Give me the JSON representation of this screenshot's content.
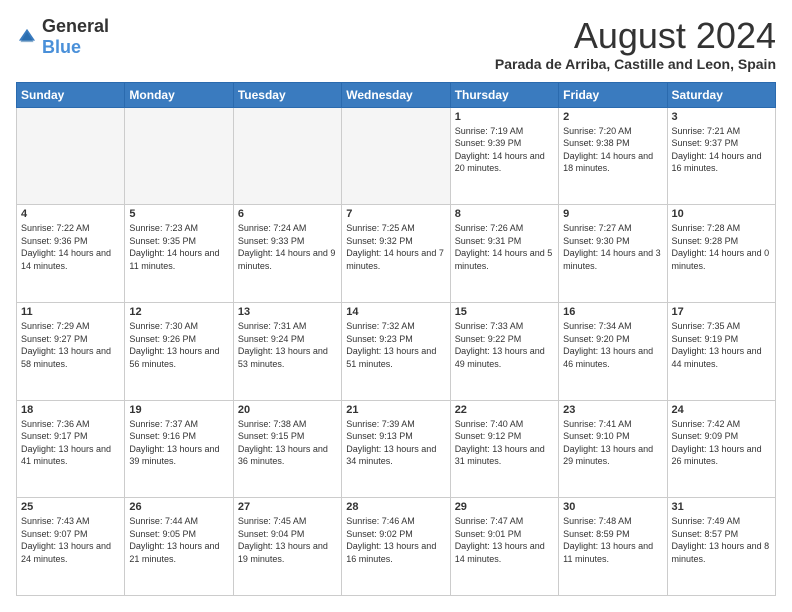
{
  "header": {
    "logo": {
      "general": "General",
      "blue": "Blue"
    },
    "title": "August 2024",
    "location": "Parada de Arriba, Castille and Leon, Spain"
  },
  "days_of_week": [
    "Sunday",
    "Monday",
    "Tuesday",
    "Wednesday",
    "Thursday",
    "Friday",
    "Saturday"
  ],
  "weeks": [
    [
      {
        "day": "",
        "info": ""
      },
      {
        "day": "",
        "info": ""
      },
      {
        "day": "",
        "info": ""
      },
      {
        "day": "",
        "info": ""
      },
      {
        "day": "1",
        "info": "Sunrise: 7:19 AM\nSunset: 9:39 PM\nDaylight: 14 hours and 20 minutes."
      },
      {
        "day": "2",
        "info": "Sunrise: 7:20 AM\nSunset: 9:38 PM\nDaylight: 14 hours and 18 minutes."
      },
      {
        "day": "3",
        "info": "Sunrise: 7:21 AM\nSunset: 9:37 PM\nDaylight: 14 hours and 16 minutes."
      }
    ],
    [
      {
        "day": "4",
        "info": "Sunrise: 7:22 AM\nSunset: 9:36 PM\nDaylight: 14 hours and 14 minutes."
      },
      {
        "day": "5",
        "info": "Sunrise: 7:23 AM\nSunset: 9:35 PM\nDaylight: 14 hours and 11 minutes."
      },
      {
        "day": "6",
        "info": "Sunrise: 7:24 AM\nSunset: 9:33 PM\nDaylight: 14 hours and 9 minutes."
      },
      {
        "day": "7",
        "info": "Sunrise: 7:25 AM\nSunset: 9:32 PM\nDaylight: 14 hours and 7 minutes."
      },
      {
        "day": "8",
        "info": "Sunrise: 7:26 AM\nSunset: 9:31 PM\nDaylight: 14 hours and 5 minutes."
      },
      {
        "day": "9",
        "info": "Sunrise: 7:27 AM\nSunset: 9:30 PM\nDaylight: 14 hours and 3 minutes."
      },
      {
        "day": "10",
        "info": "Sunrise: 7:28 AM\nSunset: 9:28 PM\nDaylight: 14 hours and 0 minutes."
      }
    ],
    [
      {
        "day": "11",
        "info": "Sunrise: 7:29 AM\nSunset: 9:27 PM\nDaylight: 13 hours and 58 minutes."
      },
      {
        "day": "12",
        "info": "Sunrise: 7:30 AM\nSunset: 9:26 PM\nDaylight: 13 hours and 56 minutes."
      },
      {
        "day": "13",
        "info": "Sunrise: 7:31 AM\nSunset: 9:24 PM\nDaylight: 13 hours and 53 minutes."
      },
      {
        "day": "14",
        "info": "Sunrise: 7:32 AM\nSunset: 9:23 PM\nDaylight: 13 hours and 51 minutes."
      },
      {
        "day": "15",
        "info": "Sunrise: 7:33 AM\nSunset: 9:22 PM\nDaylight: 13 hours and 49 minutes."
      },
      {
        "day": "16",
        "info": "Sunrise: 7:34 AM\nSunset: 9:20 PM\nDaylight: 13 hours and 46 minutes."
      },
      {
        "day": "17",
        "info": "Sunrise: 7:35 AM\nSunset: 9:19 PM\nDaylight: 13 hours and 44 minutes."
      }
    ],
    [
      {
        "day": "18",
        "info": "Sunrise: 7:36 AM\nSunset: 9:17 PM\nDaylight: 13 hours and 41 minutes."
      },
      {
        "day": "19",
        "info": "Sunrise: 7:37 AM\nSunset: 9:16 PM\nDaylight: 13 hours and 39 minutes."
      },
      {
        "day": "20",
        "info": "Sunrise: 7:38 AM\nSunset: 9:15 PM\nDaylight: 13 hours and 36 minutes."
      },
      {
        "day": "21",
        "info": "Sunrise: 7:39 AM\nSunset: 9:13 PM\nDaylight: 13 hours and 34 minutes."
      },
      {
        "day": "22",
        "info": "Sunrise: 7:40 AM\nSunset: 9:12 PM\nDaylight: 13 hours and 31 minutes."
      },
      {
        "day": "23",
        "info": "Sunrise: 7:41 AM\nSunset: 9:10 PM\nDaylight: 13 hours and 29 minutes."
      },
      {
        "day": "24",
        "info": "Sunrise: 7:42 AM\nSunset: 9:09 PM\nDaylight: 13 hours and 26 minutes."
      }
    ],
    [
      {
        "day": "25",
        "info": "Sunrise: 7:43 AM\nSunset: 9:07 PM\nDaylight: 13 hours and 24 minutes."
      },
      {
        "day": "26",
        "info": "Sunrise: 7:44 AM\nSunset: 9:05 PM\nDaylight: 13 hours and 21 minutes."
      },
      {
        "day": "27",
        "info": "Sunrise: 7:45 AM\nSunset: 9:04 PM\nDaylight: 13 hours and 19 minutes."
      },
      {
        "day": "28",
        "info": "Sunrise: 7:46 AM\nSunset: 9:02 PM\nDaylight: 13 hours and 16 minutes."
      },
      {
        "day": "29",
        "info": "Sunrise: 7:47 AM\nSunset: 9:01 PM\nDaylight: 13 hours and 14 minutes."
      },
      {
        "day": "30",
        "info": "Sunrise: 7:48 AM\nSunset: 8:59 PM\nDaylight: 13 hours and 11 minutes."
      },
      {
        "day": "31",
        "info": "Sunrise: 7:49 AM\nSunset: 8:57 PM\nDaylight: 13 hours and 8 minutes."
      }
    ]
  ]
}
